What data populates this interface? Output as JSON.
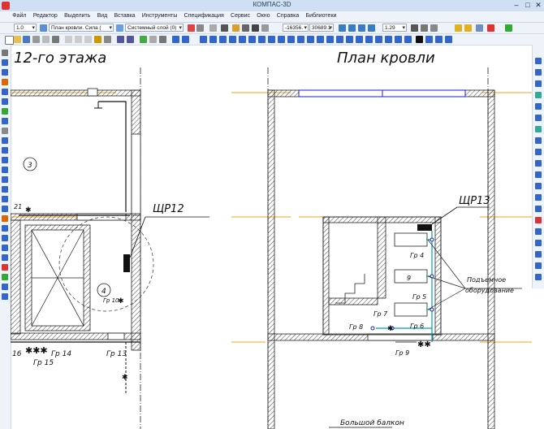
{
  "window": {
    "title": "КОМПАС-3D"
  },
  "menu": [
    "Файл",
    "Редактор",
    "Выделить",
    "Вид",
    "Вставка",
    "Инструменты",
    "Спецификация",
    "Сервис",
    "Окно",
    "Справка",
    "Библиотеки"
  ],
  "toolbar1": {
    "scale": "1.0",
    "layer_name": "План кровли. Сила (",
    "style_name": "Системный слой (0)",
    "coord_x": "-16356.",
    "coord_y": "30689.1",
    "zoom": "1.29"
  },
  "drawing": {
    "left_title": "12-го этажа",
    "right_title": "План кровли",
    "room_number": "3",
    "room_number_2": "4",
    "label_21": "21",
    "label_16": "16",
    "panel_left": "ЩР12",
    "panel_right": "ЩР13",
    "lift_label_1": "Подъемное",
    "lift_label_2": "оборудование",
    "gr4": "Гр 4",
    "gr5": "Гр 5",
    "gr6": "Гр 6",
    "gr7": "Гр 7",
    "gr8": "Гр 8",
    "gr9": "Гр 9",
    "gr10": "Гр 10",
    "gr13": "Гр 13",
    "gr14": "Гр 14",
    "gr15": "Гр 15",
    "balcony": "Большой балкон",
    "num_9": "9"
  },
  "colors": {
    "axis": "#f0a020",
    "wire": "#00a0b0",
    "blue": "#1a1adc",
    "wall_hatch": "#444444"
  }
}
